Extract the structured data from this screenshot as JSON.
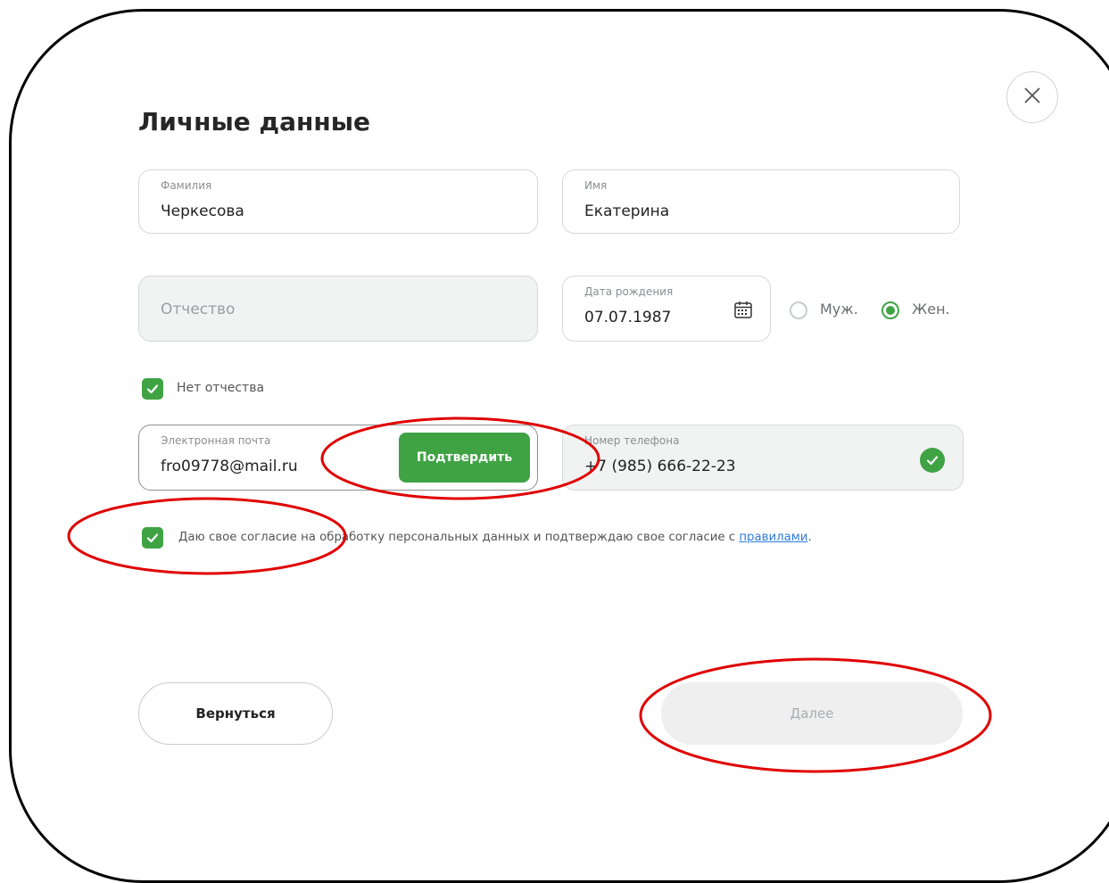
{
  "form": {
    "title": "Личные данные",
    "last_name": {
      "label": "Фамилия",
      "value": "Черкесова"
    },
    "first_name": {
      "label": "Имя",
      "value": "Екатерина"
    },
    "middle_name": {
      "placeholder": "Отчество"
    },
    "birth_date": {
      "label": "Дата рождения",
      "value": "07.07.1987"
    },
    "gender": {
      "male_label": "Муж.",
      "female_label": "Жен.",
      "selected": "female"
    },
    "no_middle_name": {
      "label": "Нет отчества",
      "checked": true
    },
    "email": {
      "label": "Электронная почта",
      "value": "fro09778@mail.ru"
    },
    "confirm_label": "Подтвердить",
    "phone": {
      "label": "Номер телефона",
      "value": "+7 (985) 666-22-23",
      "verified": true
    },
    "consent": {
      "text": "Даю свое согласие на обработку персональных данных и подтверждаю свое согласие с ",
      "link": "правилами",
      "suffix": ".",
      "checked": true
    },
    "back_label": "Вернуться",
    "next_label": "Далее"
  },
  "colors": {
    "accent": "#3fa344",
    "link": "#2d7be0",
    "annotation": "#e00000"
  }
}
